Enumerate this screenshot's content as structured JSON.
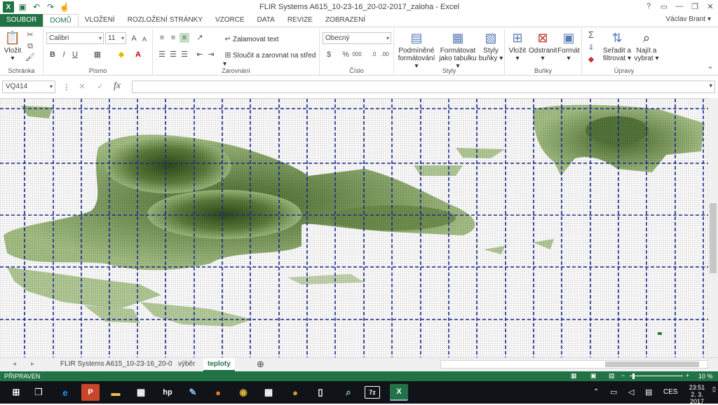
{
  "window": {
    "title": "FLIR Systems A615_10-23-16_20-02-2017_zaloha - Excel",
    "user": "Václav Brant"
  },
  "quick_access": [
    "save-icon",
    "undo-icon",
    "redo-icon",
    "touch-mode-icon"
  ],
  "ribbon_tabs": [
    "SOUBOR",
    "DOMŮ",
    "VLOŽENÍ",
    "ROZLOŽENÍ STRÁNKY",
    "VZORCE",
    "DATA",
    "REVIZE",
    "ZOBRAZENÍ"
  ],
  "ribbon": {
    "clipboard": {
      "paste": "Vložit",
      "group": "Schránka"
    },
    "font": {
      "name": "Calibri",
      "size": "11",
      "group": "Písmo",
      "bold": "B",
      "italic": "I",
      "underline": "U"
    },
    "alignment": {
      "wrap": "Zalamovat text",
      "merge": "Sloučit a zarovnat na střed",
      "group": "Zarovnání"
    },
    "number": {
      "format": "Obecný",
      "group": "Číslo"
    },
    "styles": {
      "cond1": "Podmíněné",
      "cond2": "formátování",
      "table1": "Formátovat",
      "table2": "jako tabulku",
      "cell1": "Styly",
      "cell2": "buňky",
      "group": "Styly"
    },
    "cells": {
      "insert": "Vložit",
      "delete": "Odstranit",
      "format": "Formát",
      "group": "Buňky"
    },
    "editing": {
      "sort1": "Seřadit a",
      "sort2": "filtrovat",
      "find1": "Najít a",
      "find2": "vybrat",
      "group": "Úpravy"
    }
  },
  "formula_bar": {
    "name_box": "VQ414",
    "fx": "fx",
    "value": ""
  },
  "sheets": [
    "FLIR Systems A615_10-23-16_20-0",
    "výběr",
    "teploty"
  ],
  "active_sheet": "teploty",
  "status": {
    "left": "PŘIPRAVEN",
    "zoom": "10 %"
  },
  "taskbar": {
    "lang": "CES",
    "time": "23:51",
    "date": "2. 3. 2017"
  },
  "colors": {
    "accent": "#217346",
    "heat_dark": "#3d5a22",
    "heat_light": "#a9c48a",
    "page_break": "#1c2a8c"
  }
}
